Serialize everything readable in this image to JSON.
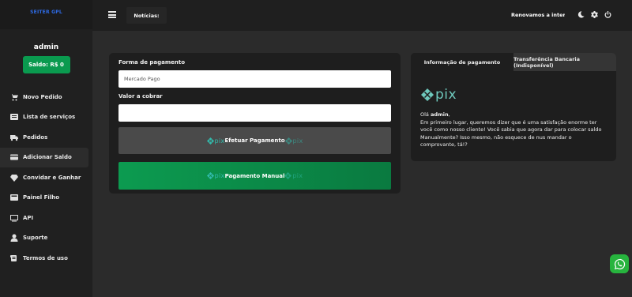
{
  "brand": "SEITER GPL",
  "user": {
    "name": "admin",
    "balance_label": "Saldo: R$ 0"
  },
  "nav": [
    {
      "label": "Novo Pedido",
      "icon": "cart-icon"
    },
    {
      "label": "Lista de serviços",
      "icon": "list-icon"
    },
    {
      "label": "Pedidos",
      "icon": "truck-icon"
    },
    {
      "label": "Adicionar Saldo",
      "icon": "credit-card-icon",
      "active": true
    },
    {
      "label": "Convidar e Ganhar",
      "icon": "gem-icon"
    },
    {
      "label": "Painel Filho",
      "icon": "panel-icon"
    },
    {
      "label": "API",
      "icon": "terminal-icon"
    },
    {
      "label": "Suporte",
      "icon": "user-icon"
    },
    {
      "label": "Termos de uso",
      "icon": "scroll-icon"
    }
  ],
  "topbar": {
    "news_label": "Notícias:",
    "marquee_text": "Renovamos a interface"
  },
  "payment": {
    "method_label": "Forma de pagamento",
    "method_value": "Mercado Pago",
    "amount_label": "Valor a cobrar",
    "amount_value": "",
    "pix_text": "pix",
    "pay_button": "Efetuar Pagamento",
    "manual_button": "Pagamento Manual"
  },
  "info": {
    "tab_active": "Informação de pagamento",
    "tab_inactive": "Transferência Bancaria (Indisponível)",
    "pix_text": "pix",
    "greeting_prefix": "Olá ",
    "greeting_name": "admin",
    "greeting_suffix": ",",
    "message": "Em primeiro lugar, queremos dizer que é uma satisfação enorme ter você como nosso cliente! Você sabia que agora dar para colocar saldo Manualmente? Isso mesmo, não esquece de nus mandar o comprovante, tá!?"
  },
  "colors": {
    "accent_green": "#0a9a4f",
    "pix_teal": "#32bcad",
    "brand_blue": "#2e6be6"
  }
}
